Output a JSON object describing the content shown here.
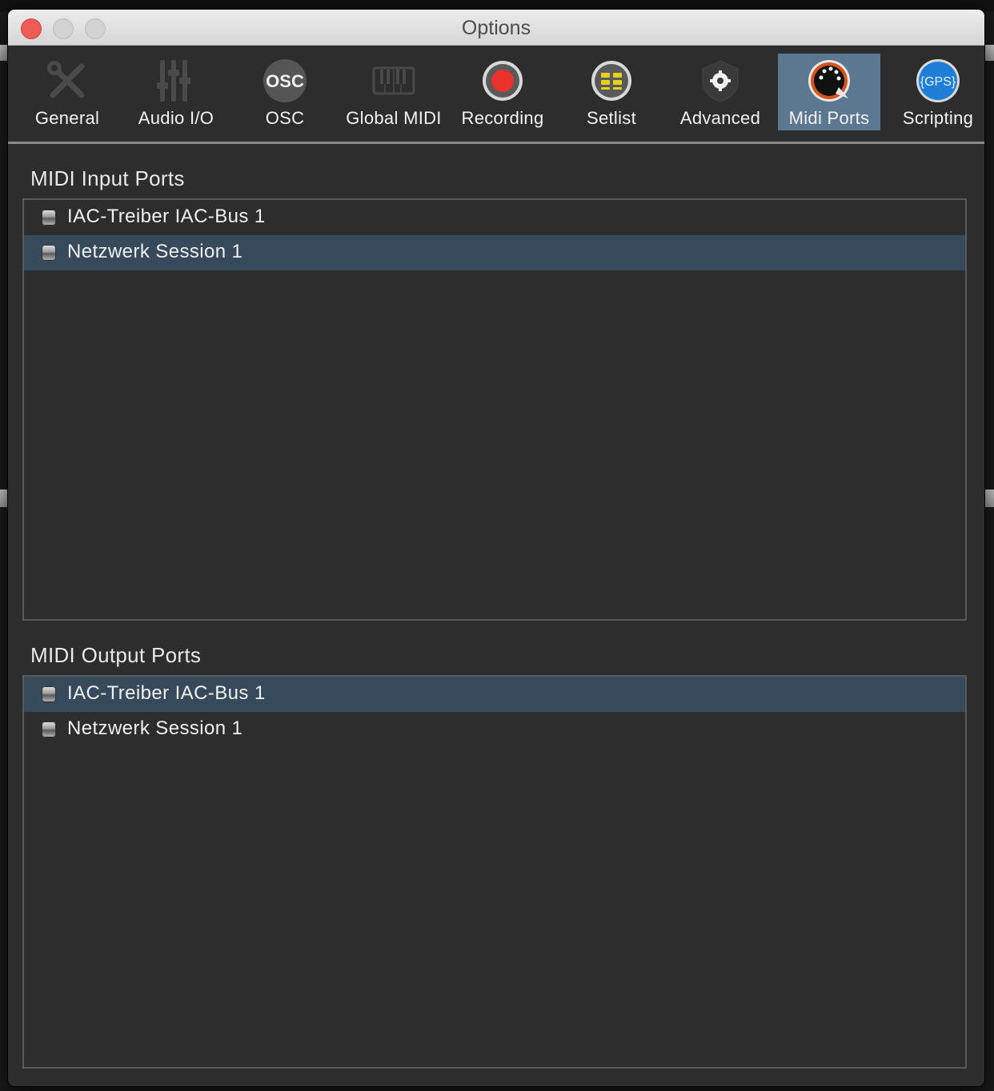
{
  "window": {
    "title": "Options"
  },
  "toolbar": {
    "items": [
      {
        "label": "General",
        "icon": "wrench-screwdriver-icon"
      },
      {
        "label": "Audio I/O",
        "icon": "mixer-faders-icon"
      },
      {
        "label": "OSC",
        "icon": "osc-icon",
        "icon_text": "OSC"
      },
      {
        "label": "Global MIDI",
        "icon": "keyboard-icon"
      },
      {
        "label": "Recording",
        "icon": "record-icon"
      },
      {
        "label": "Setlist",
        "icon": "setlist-icon"
      },
      {
        "label": "Advanced",
        "icon": "gear-shield-icon"
      },
      {
        "label": "Midi Ports",
        "icon": "midi-port-icon",
        "active": true
      },
      {
        "label": "Scripting",
        "icon": "gps-script-icon",
        "icon_text": "{GPS}"
      }
    ],
    "active_color": "#5c7891"
  },
  "midi_input": {
    "heading": "MIDI Input Ports",
    "ports": [
      {
        "name": "IAC-Treiber IAC-Bus 1",
        "selected": false
      },
      {
        "name": "Netzwerk Session 1",
        "selected": true
      }
    ]
  },
  "midi_output": {
    "heading": "MIDI Output Ports",
    "ports": [
      {
        "name": "IAC-Treiber IAC-Bus 1",
        "selected": true
      },
      {
        "name": "Netzwerk Session 1",
        "selected": false
      }
    ]
  },
  "colors": {
    "selection": "#364a5b",
    "panel": "#2d2d2d",
    "close_button": "#ee5c57",
    "record_red": "#e8322b",
    "setlist_yellow": "#e6d21a",
    "scripting_blue": "#1f7fd8"
  }
}
